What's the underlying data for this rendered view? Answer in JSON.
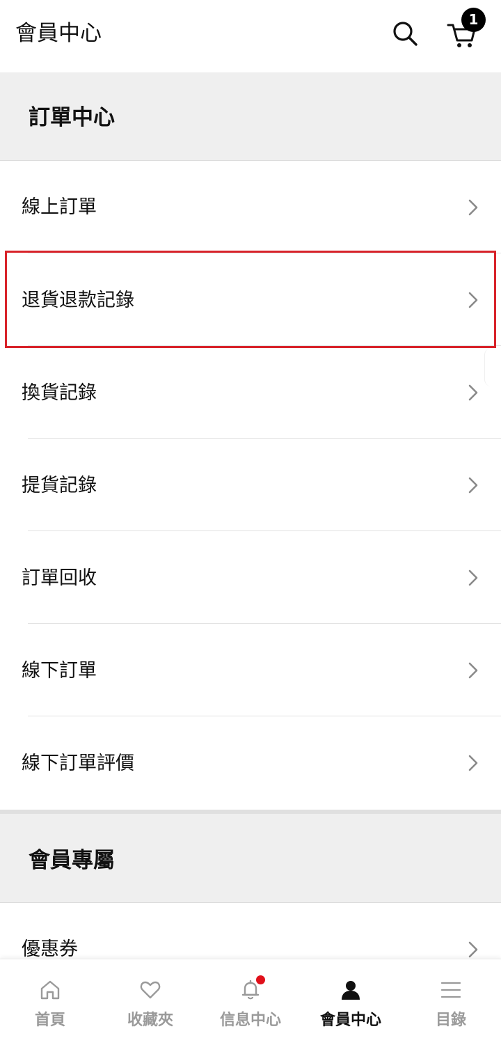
{
  "header": {
    "title": "會員中心",
    "search_icon": "search-icon",
    "cart_icon": "cart-icon",
    "cart_count": "1"
  },
  "sections": [
    {
      "title": "訂單中心",
      "items": [
        {
          "label": "線上訂單"
        },
        {
          "label": "退貨退款記錄"
        },
        {
          "label": "換貨記錄"
        },
        {
          "label": "提貨記錄"
        },
        {
          "label": "訂單回收"
        },
        {
          "label": "線下訂單"
        },
        {
          "label": "線下訂單評價"
        }
      ]
    },
    {
      "title": "會員專屬",
      "items": [
        {
          "label": "優惠券"
        }
      ]
    }
  ],
  "bottom_nav": [
    {
      "label": "首頁",
      "icon": "home-icon"
    },
    {
      "label": "收藏夾",
      "icon": "heart-icon"
    },
    {
      "label": "信息中心",
      "icon": "bell-icon"
    },
    {
      "label": "會員中心",
      "icon": "user-icon"
    },
    {
      "label": "目錄",
      "icon": "menu-icon"
    }
  ],
  "colors": {
    "highlight": "#d8232a",
    "notification_dot": "#e0101a",
    "active_nav": "#111111",
    "inactive_nav": "#9a9a9a",
    "section_bg": "#efefef"
  }
}
